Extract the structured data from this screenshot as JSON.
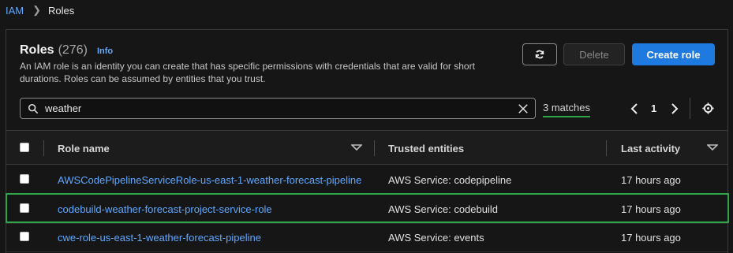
{
  "breadcrumb": {
    "parent": "IAM",
    "current": "Roles"
  },
  "header": {
    "title": "Roles",
    "count": "(276)",
    "info": "Info",
    "description": "An IAM role is an identity you can create that has specific permissions with credentials that are valid for short durations. Roles can be assumed by entities that you trust."
  },
  "actions": {
    "delete_label": "Delete",
    "create_label": "Create role"
  },
  "search": {
    "value": "weather",
    "matches": "3 matches"
  },
  "pagination": {
    "page": "1"
  },
  "table": {
    "columns": [
      "Role name",
      "Trusted entities",
      "Last activity"
    ],
    "rows": [
      {
        "role_name": "AWSCodePipelineServiceRole-us-east-1-weather-forecast-pipeline",
        "trusted": "AWS Service: codepipeline",
        "last_activity": "17 hours ago"
      },
      {
        "role_name": "codebuild-weather-forecast-project-service-role",
        "trusted": "AWS Service: codebuild",
        "last_activity": "17 hours ago"
      },
      {
        "role_name": "cwe-role-us-east-1-weather-forecast-pipeline",
        "trusted": "AWS Service: events",
        "last_activity": "17 hours ago"
      }
    ]
  },
  "colors": {
    "accent": "#1f7ae0",
    "link": "#5fa8ff",
    "highlight": "#2fa54a",
    "background": "#161616"
  }
}
